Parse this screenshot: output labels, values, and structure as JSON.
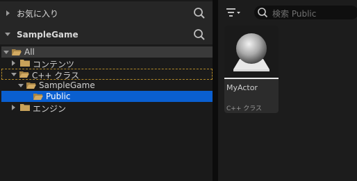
{
  "favorites": {
    "title": "お気に入り"
  },
  "project": {
    "title": "SampleGame"
  },
  "tree": {
    "all": "All",
    "contents": "コンテンツ",
    "cpp_classes": "C++ クラス",
    "samplegame": "SampleGame",
    "public": "Public",
    "engine": "エンジン"
  },
  "toolbar": {
    "search_placeholder": "検索 Public"
  },
  "asset": {
    "name": "MyActor",
    "type": "C++ クラス"
  },
  "colors": {
    "selection": "#0a5fd0",
    "folder": "#c8a25a",
    "accent_outline": "#b38a2a"
  },
  "icons": [
    "search-icon",
    "folder-icon",
    "open-folder-icon",
    "filter-icon",
    "sphere-actor-icon",
    "expand-arrow-icon",
    "collapse-arrow-icon"
  ]
}
